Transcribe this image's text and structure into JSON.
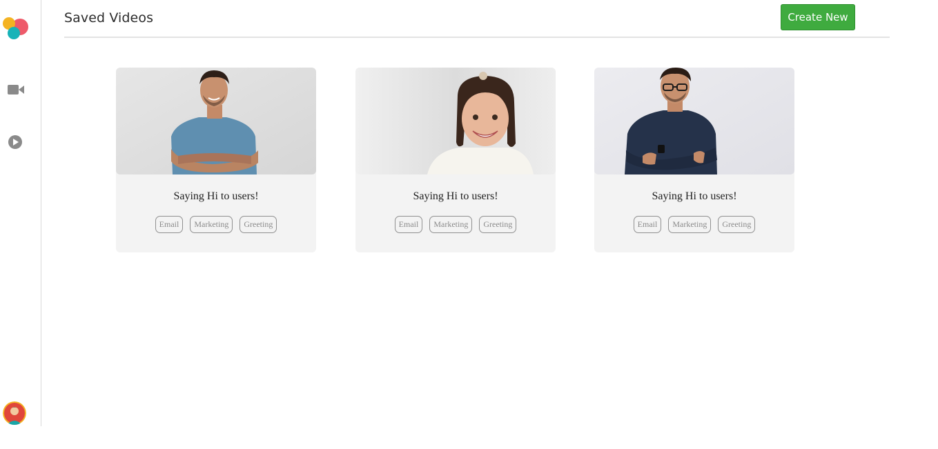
{
  "header": {
    "title": "Saved Videos",
    "create_label": "Create New"
  },
  "colors": {
    "accent": "#3fab3f",
    "card_bg": "#f3f3f3",
    "logo_red": "#ee5a6a",
    "logo_yellow": "#f4b322",
    "logo_teal": "#17b3b8"
  },
  "sidebar": {
    "items": [
      {
        "icon": "video-camera-icon"
      },
      {
        "icon": "play-circle-icon"
      }
    ],
    "avatar": "user-avatar"
  },
  "videos": [
    {
      "title": "Saying Hi to users!",
      "tags": [
        "Email",
        "Marketing",
        "Greeting"
      ]
    },
    {
      "title": "Saying Hi to users!",
      "tags": [
        "Email",
        "Marketing",
        "Greeting"
      ]
    },
    {
      "title": "Saying Hi to users!",
      "tags": [
        "Email",
        "Marketing",
        "Greeting"
      ]
    }
  ]
}
